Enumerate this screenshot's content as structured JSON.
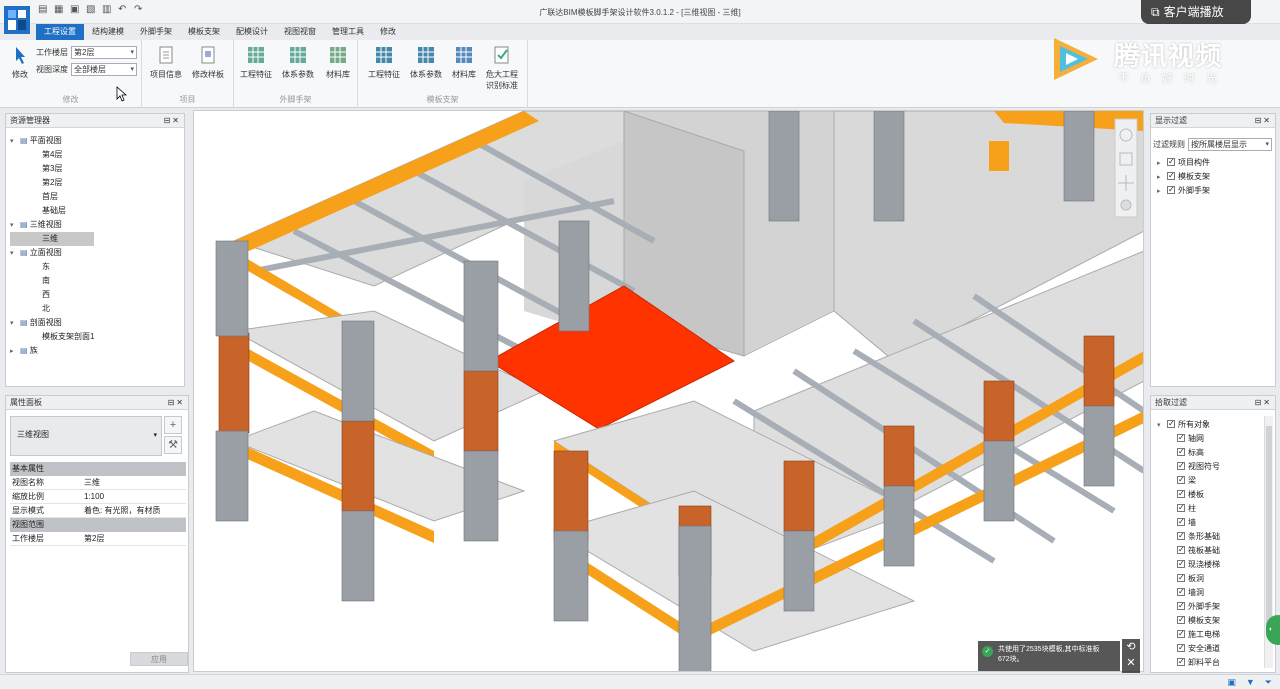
{
  "title": "广联达BIM模板脚手架设计软件3.0.1.2 - [三维视图 - 三维]",
  "cast_button": "客户端播放",
  "watermark": {
    "name": "腾讯视频",
    "slogan": "不负好时光"
  },
  "ribbon_tabs": [
    "工程设置",
    "结构建模",
    "外脚手架",
    "模板支架",
    "配模设计",
    "视图视窗",
    "管理工具",
    "修改"
  ],
  "active_tab": "工程设置",
  "ribbon": {
    "modify": "修改",
    "floor_label": "工作楼层",
    "floor_value": "第2层",
    "depth_label": "视图深度",
    "depth_value": "全部楼层",
    "group_modify": "修改",
    "project_info": "项目信息",
    "edit_template": "修改样板",
    "group_project": "项目",
    "scaffold_feature": "工程特征",
    "scaffold_params": "体系参数",
    "scaffold_materials": "材料库",
    "group_scaffold": "外脚手架",
    "support_feature": "工程特征",
    "support_params": "体系参数",
    "support_materials": "材料库",
    "danger_standard_1": "危大工程",
    "danger_standard_2": "识别标准",
    "group_support": "模板支架"
  },
  "resource_manager": {
    "title": "资源管理器",
    "tree": [
      {
        "label": "平面视图",
        "level": 0,
        "expand": true,
        "icon": true
      },
      {
        "label": "第4层",
        "level": 1
      },
      {
        "label": "第3层",
        "level": 1
      },
      {
        "label": "第2层",
        "level": 1
      },
      {
        "label": "首层",
        "level": 1
      },
      {
        "label": "基础层",
        "level": 1
      },
      {
        "label": "三维视图",
        "level": 0,
        "expand": true,
        "icon": true
      },
      {
        "label": "三维",
        "level": 1,
        "selected": true
      },
      {
        "label": "立面视图",
        "level": 0,
        "expand": true,
        "icon": true
      },
      {
        "label": "东",
        "level": 1
      },
      {
        "label": "南",
        "level": 1
      },
      {
        "label": "西",
        "level": 1
      },
      {
        "label": "北",
        "level": 1
      },
      {
        "label": "剖面视图",
        "level": 0,
        "expand": true,
        "icon": true
      },
      {
        "label": "模板支架剖面1",
        "level": 1
      },
      {
        "label": "族",
        "level": 0,
        "expand": false,
        "icon": true
      }
    ]
  },
  "properties": {
    "title": "属性面板",
    "type_name": "三维视图",
    "section_basic": "基本属性",
    "rows_basic": [
      {
        "k": "视图名称",
        "v": "三维"
      },
      {
        "k": "缩放比例",
        "v": "1:100"
      },
      {
        "k": "显示模式",
        "v": "着色: 有光照，有材质"
      }
    ],
    "section_range": "视图范围",
    "rows_range": [
      {
        "k": "工作楼层",
        "v": "第2层"
      }
    ],
    "apply": "应用"
  },
  "display_filter": {
    "title": "显示过滤",
    "rule_label": "过滤规则",
    "rule_value": "按所属楼层显示",
    "items": [
      "项目构件",
      "模板支架",
      "外脚手架"
    ]
  },
  "pick_filter": {
    "title": "拾取过滤",
    "all": "所有对象",
    "items": [
      "轴网",
      "标高",
      "视图符号",
      "梁",
      "楼板",
      "柱",
      "墙",
      "条形基础",
      "筏板基础",
      "现浇楼梯",
      "板洞",
      "墙洞",
      "外脚手架",
      "模板支架",
      "施工电梯",
      "安全通道",
      "卸料平台"
    ]
  },
  "toast": {
    "line1": "共使用了2535块模板,其中标准板",
    "line2": "672块。"
  },
  "colors": {
    "accent": "#1f6fc5",
    "beam_orange": "#f7a01a",
    "slab_red": "#ff3300",
    "column_grey": "#9a9fa6",
    "brick": "#c8642a"
  }
}
